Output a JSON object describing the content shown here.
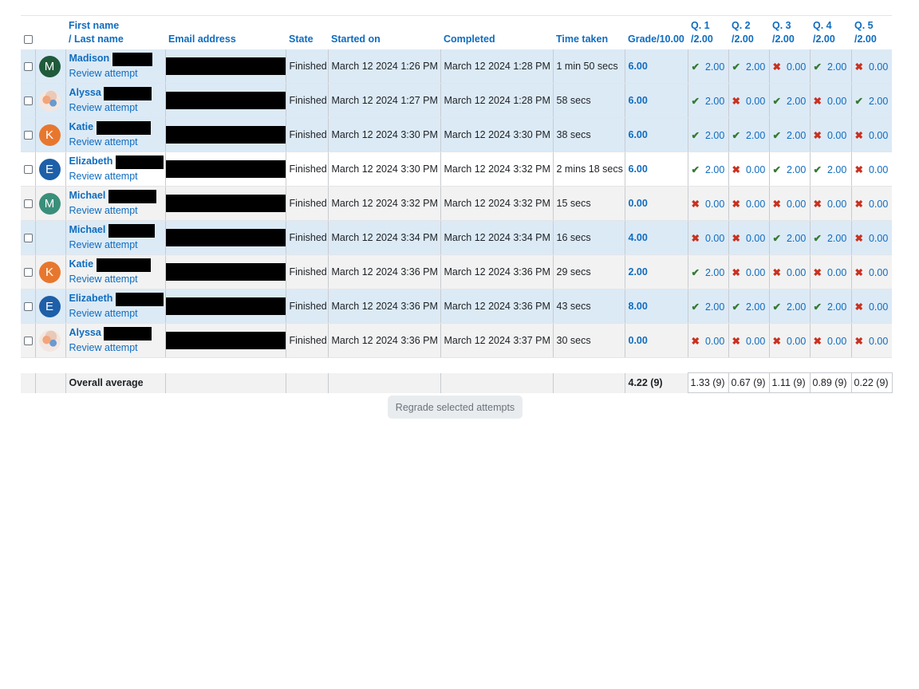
{
  "headers": {
    "first_name": "First name",
    "last_name": "/ Last name",
    "email": "Email address",
    "state": "State",
    "started": "Started on",
    "completed": "Completed",
    "time": "Time taken",
    "grade": "Grade/10.00",
    "questions": [
      {
        "num": "Q. 1",
        "max": "/2.00"
      },
      {
        "num": "Q. 2",
        "max": "/2.00"
      },
      {
        "num": "Q. 3",
        "max": "/2.00"
      },
      {
        "num": "Q. 4",
        "max": "/2.00"
      },
      {
        "num": "Q. 5",
        "max": "/2.00"
      }
    ]
  },
  "rows": [
    {
      "first": "Madison",
      "avatar": "M",
      "avatar_color": "#1f5b3a",
      "state": "Finished",
      "started": "March 12 2024 1:26 PM",
      "completed": "March 12 2024 1:28 PM",
      "time": "1 min 50 secs",
      "grade": "6.00",
      "q": [
        {
          "s": "ok",
          "v": "2.00"
        },
        {
          "s": "ok",
          "v": "2.00"
        },
        {
          "s": "bad",
          "v": "0.00"
        },
        {
          "s": "ok",
          "v": "2.00"
        },
        {
          "s": "bad",
          "v": "0.00"
        }
      ]
    },
    {
      "first": "Alyssa",
      "avatar": "",
      "avatar_color": "img",
      "state": "Finished",
      "started": "March 12 2024 1:27 PM",
      "completed": "March 12 2024 1:28 PM",
      "time": "58 secs",
      "grade": "6.00",
      "q": [
        {
          "s": "ok",
          "v": "2.00"
        },
        {
          "s": "bad",
          "v": "0.00"
        },
        {
          "s": "ok",
          "v": "2.00"
        },
        {
          "s": "bad",
          "v": "0.00"
        },
        {
          "s": "ok",
          "v": "2.00"
        }
      ]
    },
    {
      "first": "Katie",
      "avatar": "K",
      "avatar_color": "#e8772e",
      "state": "Finished",
      "started": "March 12 2024 3:30 PM",
      "completed": "March 12 2024 3:30 PM",
      "time": "38 secs",
      "grade": "6.00",
      "q": [
        {
          "s": "ok",
          "v": "2.00"
        },
        {
          "s": "ok",
          "v": "2.00"
        },
        {
          "s": "ok",
          "v": "2.00"
        },
        {
          "s": "bad",
          "v": "0.00"
        },
        {
          "s": "bad",
          "v": "0.00"
        }
      ]
    },
    {
      "first": "Elizabeth",
      "avatar": "E",
      "avatar_color": "#1d5fa8",
      "state": "Finished",
      "started": "March 12 2024 3:30 PM",
      "completed": "March 12 2024 3:32 PM",
      "time": "2 mins 18 secs",
      "grade": "6.00",
      "q": [
        {
          "s": "ok",
          "v": "2.00"
        },
        {
          "s": "bad",
          "v": "0.00"
        },
        {
          "s": "ok",
          "v": "2.00"
        },
        {
          "s": "ok",
          "v": "2.00"
        },
        {
          "s": "bad",
          "v": "0.00"
        }
      ]
    },
    {
      "first": "Michael",
      "avatar": "M",
      "avatar_color": "#3a8f7a",
      "state": "Finished",
      "started": "March 12 2024 3:32 PM",
      "completed": "March 12 2024 3:32 PM",
      "time": "15 secs",
      "grade": "0.00",
      "q": [
        {
          "s": "bad",
          "v": "0.00"
        },
        {
          "s": "bad",
          "v": "0.00"
        },
        {
          "s": "bad",
          "v": "0.00"
        },
        {
          "s": "bad",
          "v": "0.00"
        },
        {
          "s": "bad",
          "v": "0.00"
        }
      ]
    },
    {
      "first": "Michael",
      "avatar": "",
      "avatar_color": "none",
      "state": "Finished",
      "started": "March 12 2024 3:34 PM",
      "completed": "March 12 2024 3:34 PM",
      "time": "16 secs",
      "grade": "4.00",
      "q": [
        {
          "s": "bad",
          "v": "0.00"
        },
        {
          "s": "bad",
          "v": "0.00"
        },
        {
          "s": "ok",
          "v": "2.00"
        },
        {
          "s": "ok",
          "v": "2.00"
        },
        {
          "s": "bad",
          "v": "0.00"
        }
      ]
    },
    {
      "first": "Katie",
      "avatar": "K",
      "avatar_color": "#e8772e",
      "state": "Finished",
      "started": "March 12 2024 3:36 PM",
      "completed": "March 12 2024 3:36 PM",
      "time": "29 secs",
      "grade": "2.00",
      "q": [
        {
          "s": "ok",
          "v": "2.00"
        },
        {
          "s": "bad",
          "v": "0.00"
        },
        {
          "s": "bad",
          "v": "0.00"
        },
        {
          "s": "bad",
          "v": "0.00"
        },
        {
          "s": "bad",
          "v": "0.00"
        }
      ]
    },
    {
      "first": "Elizabeth",
      "avatar": "E",
      "avatar_color": "#1d5fa8",
      "state": "Finished",
      "started": "March 12 2024 3:36 PM",
      "completed": "March 12 2024 3:36 PM",
      "time": "43 secs",
      "grade": "8.00",
      "q": [
        {
          "s": "ok",
          "v": "2.00"
        },
        {
          "s": "ok",
          "v": "2.00"
        },
        {
          "s": "ok",
          "v": "2.00"
        },
        {
          "s": "ok",
          "v": "2.00"
        },
        {
          "s": "bad",
          "v": "0.00"
        }
      ]
    },
    {
      "first": "Alyssa",
      "avatar": "",
      "avatar_color": "img",
      "state": "Finished",
      "started": "March 12 2024 3:36 PM",
      "completed": "March 12 2024 3:37 PM",
      "time": "30 secs",
      "grade": "0.00",
      "q": [
        {
          "s": "bad",
          "v": "0.00"
        },
        {
          "s": "bad",
          "v": "0.00"
        },
        {
          "s": "bad",
          "v": "0.00"
        },
        {
          "s": "bad",
          "v": "0.00"
        },
        {
          "s": "bad",
          "v": "0.00"
        }
      ]
    }
  ],
  "row_bg": [
    "hl",
    "hl",
    "hl",
    "wh",
    "gr",
    "hl",
    "gr",
    "hl",
    "gr"
  ],
  "review_label": "Review attempt",
  "average": {
    "label": "Overall average",
    "grade": "4.22 (9)",
    "q": [
      "1.33 (9)",
      "0.67 (9)",
      "1.11 (9)",
      "0.89 (9)",
      "0.22 (9)"
    ]
  },
  "regrade_button": "Regrade selected attempts",
  "icons": {
    "correct": "check-icon",
    "incorrect": "cross-icon"
  },
  "colors": {
    "link": "#0f6cbf",
    "correct": "#357a32",
    "incorrect": "#ca3120",
    "highlight": "#dceaf6"
  }
}
